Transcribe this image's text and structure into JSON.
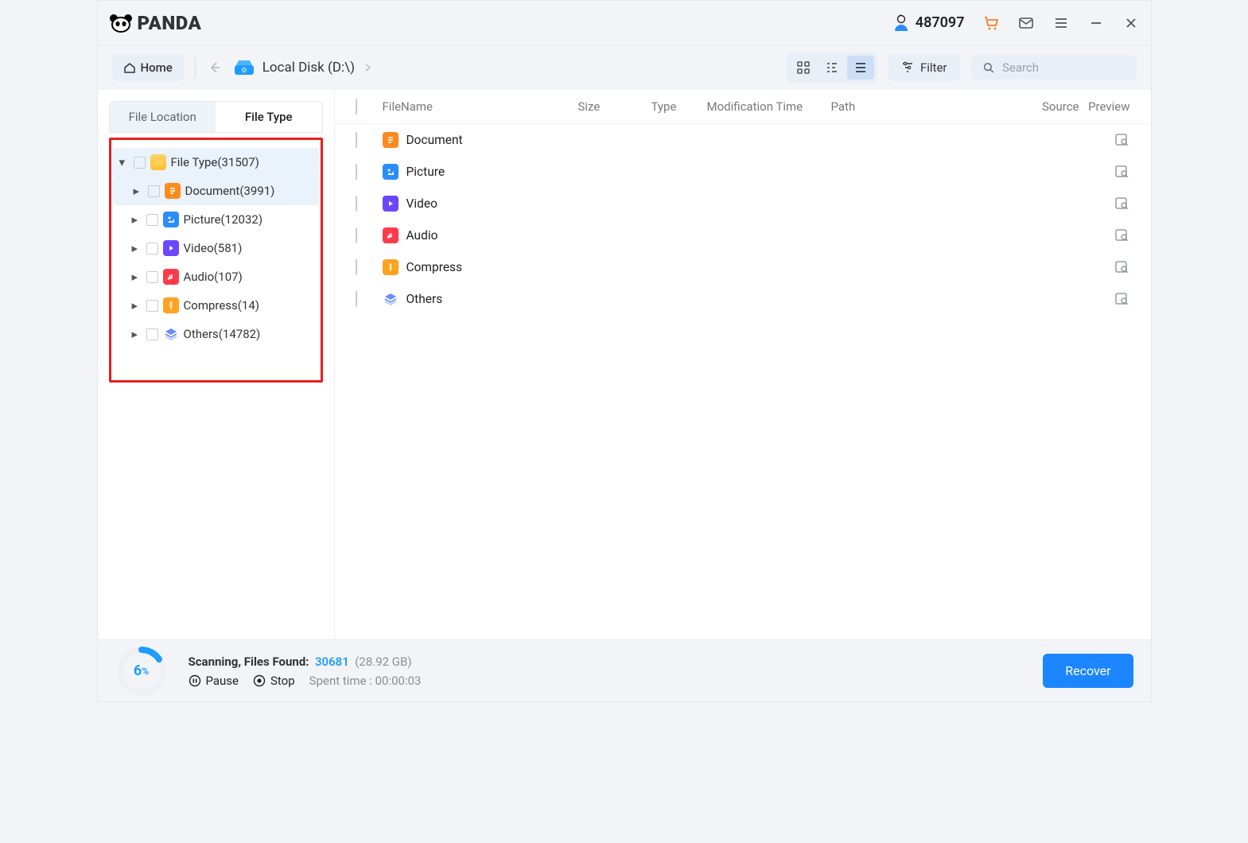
{
  "titlebar": {
    "brand": "PANDA",
    "user_count": "487097"
  },
  "toolbar": {
    "home": "Home",
    "location": "Local Disk (D:\\)",
    "filter": "Filter",
    "search_placeholder": "Search"
  },
  "sidebar": {
    "tab_location": "File Location",
    "tab_type": "File Type",
    "root_label": "File Type(31507)",
    "nodes": [
      {
        "label": "Document(3991)",
        "icon": "doc"
      },
      {
        "label": "Picture(12032)",
        "icon": "pic"
      },
      {
        "label": "Video(581)",
        "icon": "vid"
      },
      {
        "label": "Audio(107)",
        "icon": "aud"
      },
      {
        "label": "Compress(14)",
        "icon": "comp"
      },
      {
        "label": "Others(14782)",
        "icon": "oth"
      }
    ]
  },
  "columns": {
    "name": "FileName",
    "size": "Size",
    "type": "Type",
    "mod": "Modification Time",
    "path": "Path",
    "source": "Source",
    "preview": "Preview"
  },
  "rows": [
    {
      "label": "Document",
      "icon": "doc"
    },
    {
      "label": "Picture",
      "icon": "pic"
    },
    {
      "label": "Video",
      "icon": "vid"
    },
    {
      "label": "Audio",
      "icon": "aud"
    },
    {
      "label": "Compress",
      "icon": "comp"
    },
    {
      "label": "Others",
      "icon": "oth"
    }
  ],
  "footer": {
    "percent": "6",
    "percent_suffix": "%",
    "status_label": "Scanning, Files Found:",
    "files_found": "30681",
    "total_size": "(28.92 GB)",
    "pause": "Pause",
    "stop": "Stop",
    "spent_label": "Spent time : 00:00:03",
    "recover": "Recover"
  }
}
